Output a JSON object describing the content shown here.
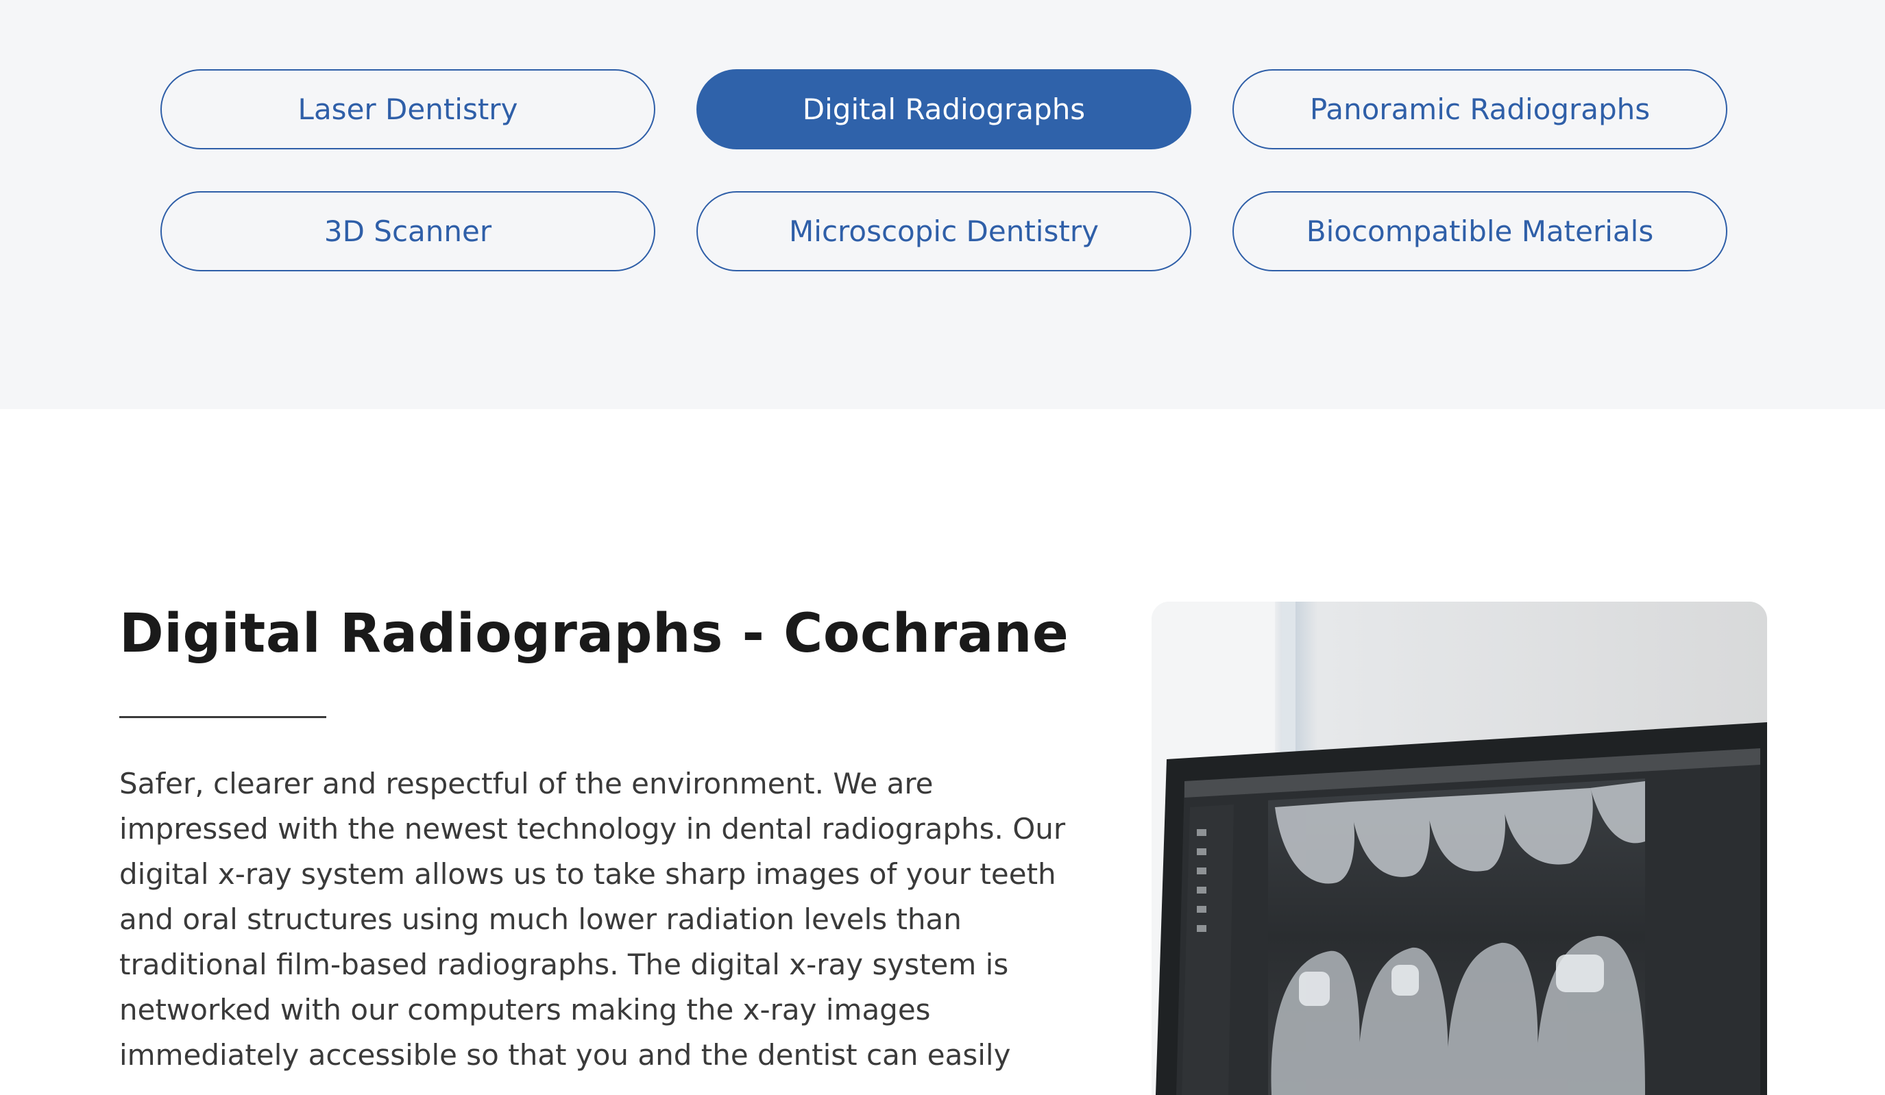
{
  "tabs": [
    {
      "label": "Laser Dentistry",
      "active": false
    },
    {
      "label": "Digital Radiographs",
      "active": true
    },
    {
      "label": "Panoramic Radiographs",
      "active": false
    },
    {
      "label": "3D Scanner",
      "active": false
    },
    {
      "label": "Microscopic Dentistry",
      "active": false
    },
    {
      "label": "Biocompatible Materials",
      "active": false
    }
  ],
  "article": {
    "title": "Digital Radiographs - Cochrane",
    "body": "Safer, clearer and respectful of the environment. We are impressed with the newest technology in dental radiographs. Our digital x-ray system allows us to take sharp images of your teeth and oral structures using much lower radiation levels than traditional film-based radiographs. The digital x-ray system is networked with our computers making the x-ray images immediately accessible so that you and the dentist can easily"
  },
  "photo": {
    "subject": "monitor-showing-dental-xray"
  },
  "colors": {
    "accent": "#2f62aa",
    "tabs_background": "#f5f6f8",
    "heading": "#1a1a1a",
    "body_text": "#3a3a3a"
  }
}
